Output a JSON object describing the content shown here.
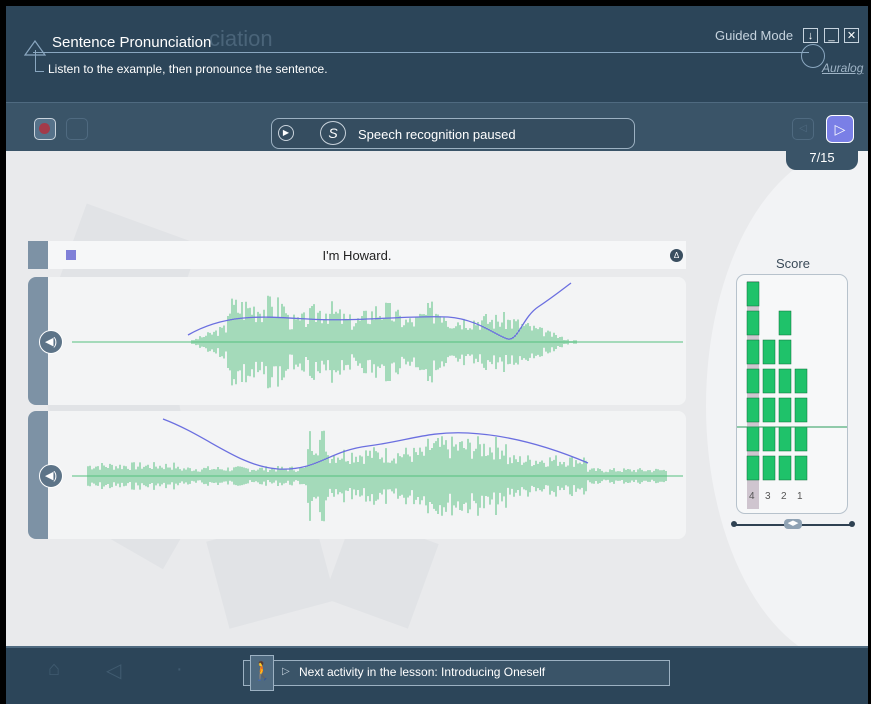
{
  "header": {
    "title": "Sentence Pronunciation",
    "title_ghost": "ciation",
    "subtitle": "Listen to the example, then pronounce the sentence.",
    "mode_label": "Guided Mode",
    "brand": "Auralog",
    "window_buttons": [
      "↓",
      "_",
      "✕"
    ]
  },
  "toolbar": {
    "status_text": "Speech recognition paused",
    "counter": "7/15"
  },
  "sentence": {
    "text": "I'm Howard."
  },
  "score": {
    "title": "Score",
    "column_labels": [
      "4",
      "3",
      "2",
      "1"
    ],
    "column_heights": [
      7,
      5,
      6,
      4
    ],
    "colors": {
      "bar": "#1fc26a",
      "threshold": "#2a9d5c"
    }
  },
  "footer": {
    "next_activity": "Next activity in the lesson: Introducing Oneself"
  },
  "colors": {
    "header": "#2c4559",
    "waveform": "#55c07f",
    "pitch": "#6b6fe0",
    "accent": "#7a7fe6"
  }
}
